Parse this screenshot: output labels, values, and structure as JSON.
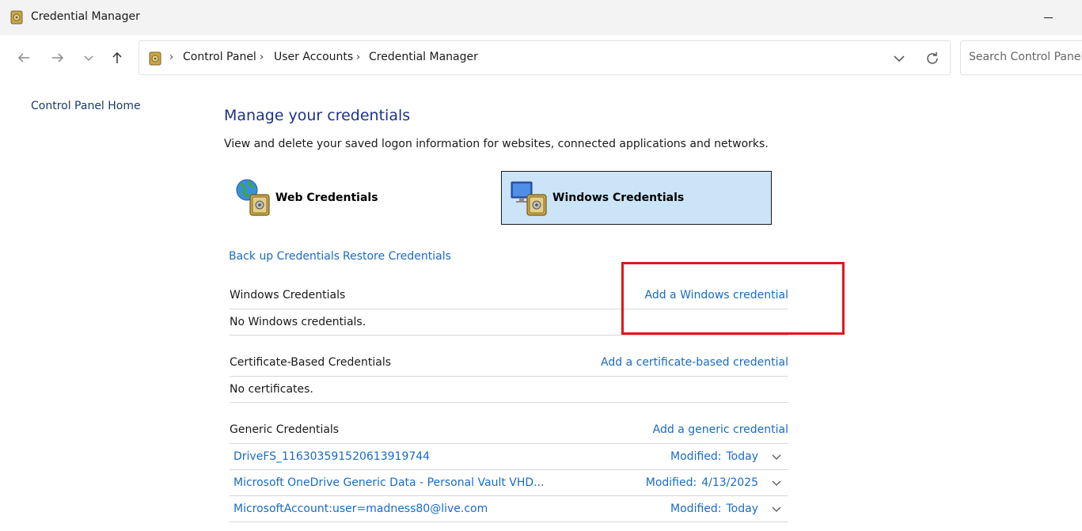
{
  "window": {
    "title": "Credential Manager"
  },
  "nav": {
    "breadcrumbs": [
      "Control Panel",
      "User Accounts",
      "Credential Manager"
    ],
    "search_placeholder": "Search Control Panel"
  },
  "left_pane": {
    "home_link": "Control Panel Home"
  },
  "main": {
    "heading": "Manage your credentials",
    "description": "View and delete your saved logon information for websites, connected applications and networks.",
    "vaults": {
      "web": "Web Credentials",
      "windows": "Windows Credentials",
      "selected": "windows"
    },
    "links": {
      "backup": "Back up Credentials",
      "restore": "Restore Credentials"
    },
    "sections": {
      "windows": {
        "title": "Windows Credentials",
        "add_link": "Add a Windows credential",
        "empty_text": "No Windows credentials."
      },
      "certificate": {
        "title": "Certificate-Based Credentials",
        "add_link": "Add a certificate-based credential",
        "empty_text": "No certificates."
      },
      "generic": {
        "title": "Generic Credentials",
        "add_link": "Add a generic credential",
        "modified_label": "Modified:",
        "items": [
          {
            "name": "DriveFS_116303591520613919744",
            "modified": "Today"
          },
          {
            "name": "Microsoft OneDrive Generic Data - Personal Vault VHD...",
            "modified": "4/13/2025"
          },
          {
            "name": "MicrosoftAccount:user=madness80@live.com",
            "modified": "Today"
          }
        ]
      }
    }
  },
  "colors": {
    "link": "#1a6bc4",
    "heading": "#1e3287",
    "selected_tile": "#cce4f7",
    "highlight": "#e3161b"
  },
  "icons": [
    "vault-icon",
    "back-arrow-icon",
    "forward-arrow-icon",
    "recent-chevron-icon",
    "up-arrow-icon",
    "breadcrumb-chevron-icon",
    "dropdown-chevron-icon",
    "refresh-icon",
    "globe-vault-icon",
    "monitor-vault-icon",
    "expand-chevron-icon",
    "minimize-icon"
  ]
}
